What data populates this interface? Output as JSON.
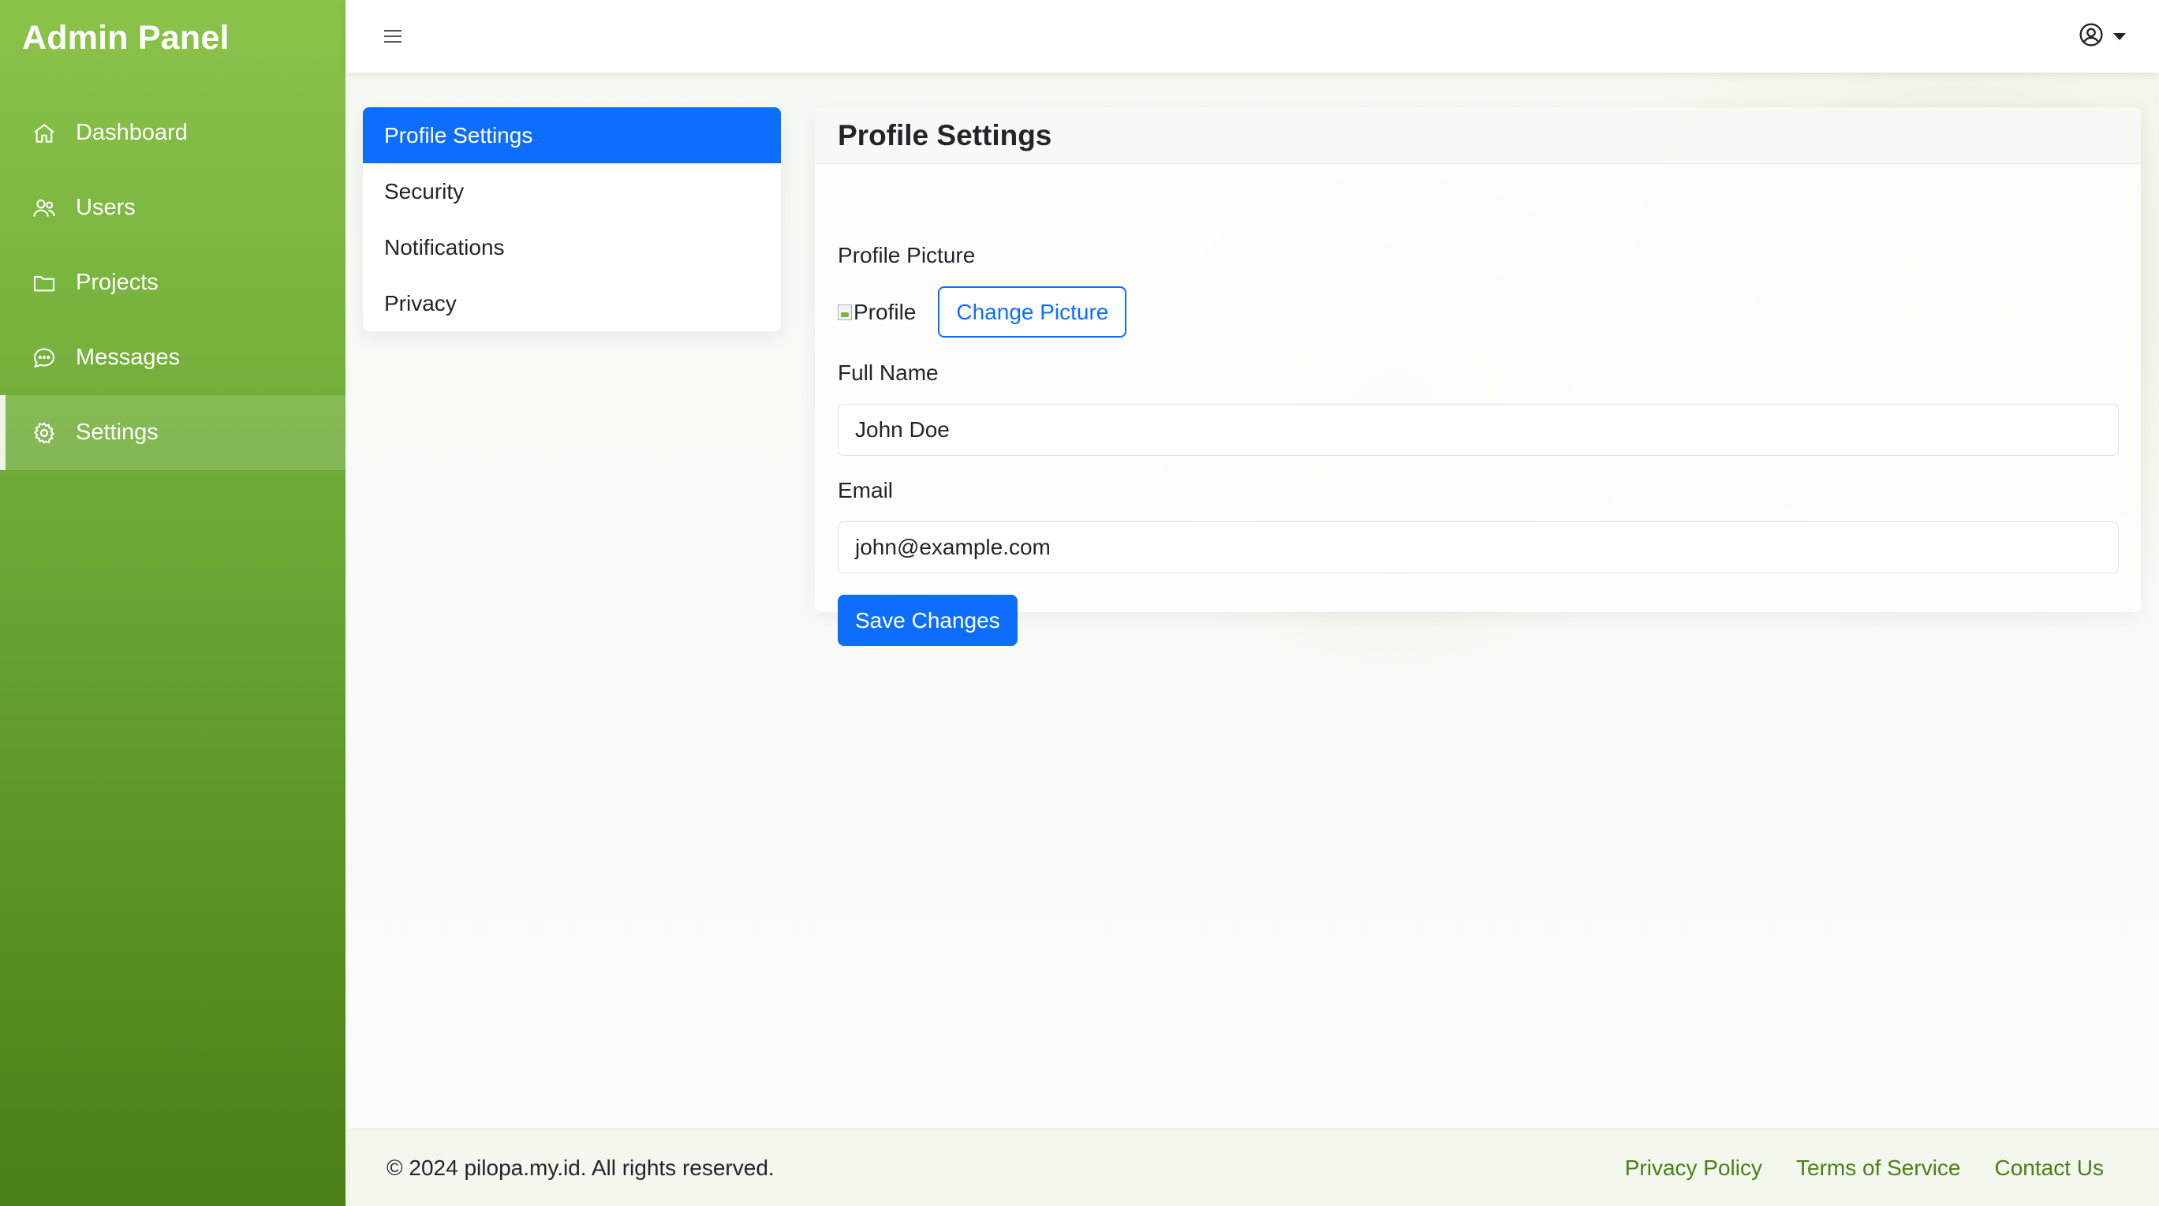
{
  "sidebar": {
    "brand": "Admin Panel",
    "items": [
      {
        "label": "Dashboard",
        "icon": "home-icon"
      },
      {
        "label": "Users",
        "icon": "users-icon"
      },
      {
        "label": "Projects",
        "icon": "folder-icon"
      },
      {
        "label": "Messages",
        "icon": "chat-icon"
      },
      {
        "label": "Settings",
        "icon": "gear-icon",
        "active": true
      }
    ]
  },
  "topbar": {
    "menu_icon": "hamburger-icon",
    "user_icon": "user-circle-icon"
  },
  "settings_menu": {
    "items": [
      {
        "label": "Profile Settings",
        "active": true
      },
      {
        "label": "Security"
      },
      {
        "label": "Notifications"
      },
      {
        "label": "Privacy"
      }
    ]
  },
  "profile_card": {
    "title": "Profile Settings",
    "picture_label": "Profile Picture",
    "picture_alt": "Profile",
    "change_picture_label": "Change Picture",
    "full_name_label": "Full Name",
    "full_name_value": "John Doe",
    "email_label": "Email",
    "email_value": "john@example.com",
    "save_label": "Save Changes"
  },
  "footer": {
    "copyright": "© 2024 pilopa.my.id. All rights reserved.",
    "links": [
      "Privacy Policy",
      "Terms of Service",
      "Contact Us"
    ]
  },
  "colors": {
    "primary": "#0d6efd",
    "sidebar_top": "#8bc34a",
    "sidebar_bottom": "#4a7f16",
    "footer_link": "#4a7f16"
  }
}
